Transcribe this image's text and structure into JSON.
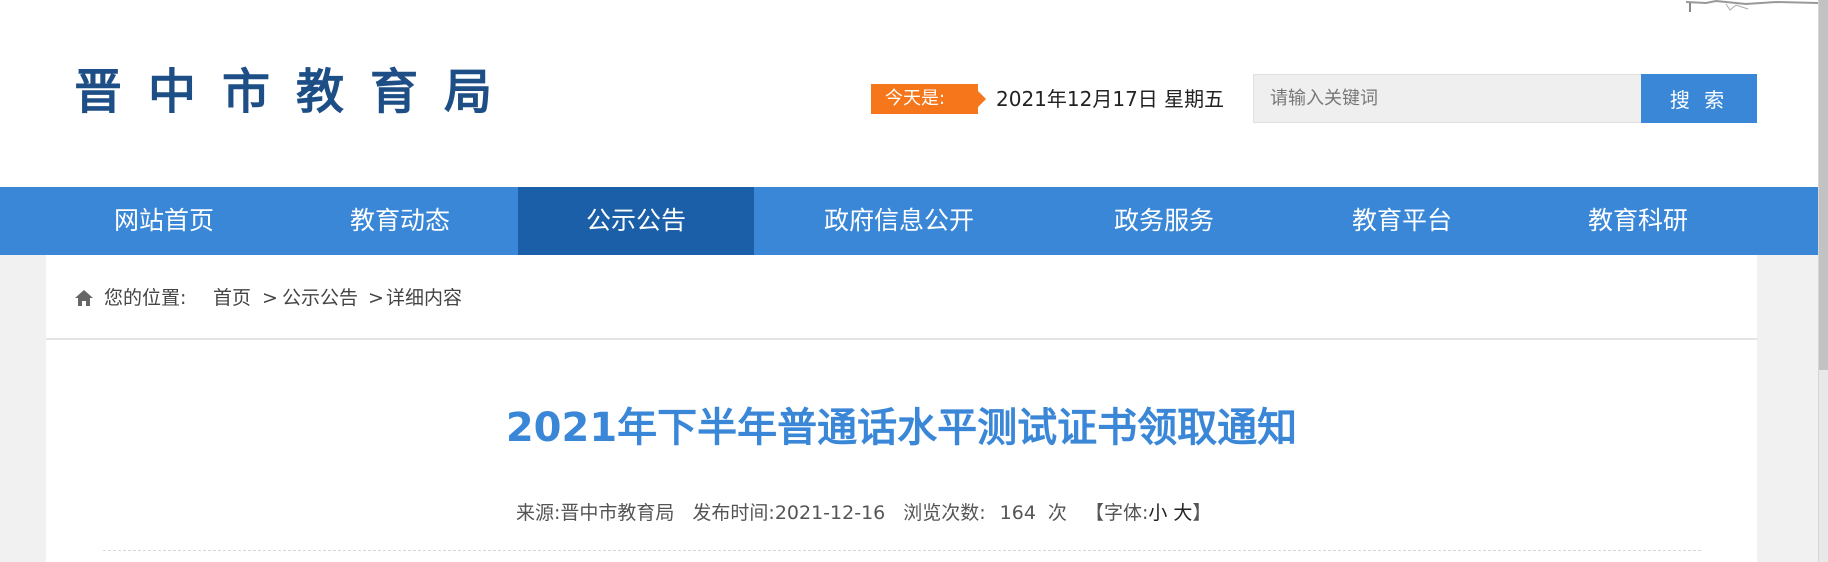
{
  "header": {
    "logo_text": "晋中市教育局",
    "today_label": "今天是:",
    "today_date": "2021年12月17日 星期五",
    "search_placeholder": "请输入关键词",
    "search_button_label": "搜 索"
  },
  "nav": {
    "items": [
      {
        "label": "网站首页"
      },
      {
        "label": "教育动态"
      },
      {
        "label": "公示公告",
        "active": true
      },
      {
        "label": "政府信息公开"
      },
      {
        "label": "政务服务"
      },
      {
        "label": "教育平台"
      },
      {
        "label": "教育科研"
      }
    ]
  },
  "breadcrumb": {
    "label": "您的位置:",
    "items": [
      "首页",
      "公示公告",
      "详细内容"
    ],
    "separator": ">"
  },
  "article": {
    "title": "2021年下半年普通话水平测试证书领取通知",
    "source_label": "来源:",
    "source": "晋中市教育局",
    "publish_label": "发布时间:",
    "publish_date": "2021-12-16",
    "views_label": "浏览次数:",
    "views": "164",
    "views_unit": "次",
    "font_label": "【字体:",
    "font_small": "小",
    "font_large": "大",
    "font_close": "】"
  },
  "colors": {
    "brand_blue": "#3a87d8",
    "nav_active": "#1b5fa8",
    "logo_blue": "#1e4e86",
    "today_orange": "#f5761b"
  }
}
